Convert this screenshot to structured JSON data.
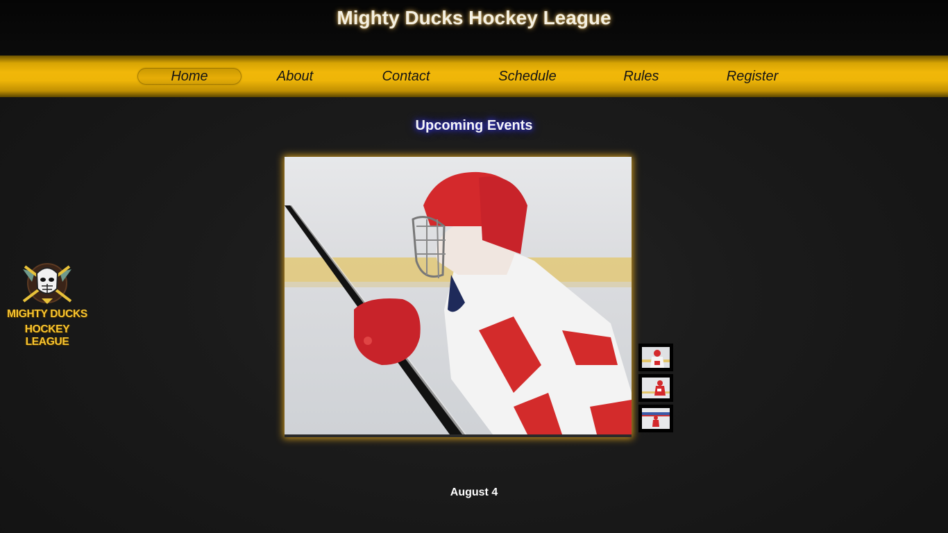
{
  "header": {
    "title": "Mighty Ducks Hockey League"
  },
  "nav": {
    "items": [
      {
        "label": "Home",
        "active": true
      },
      {
        "label": "About",
        "active": false
      },
      {
        "label": "Contact",
        "active": false
      },
      {
        "label": "Schedule",
        "active": false
      },
      {
        "label": "Rules",
        "active": false
      },
      {
        "label": "Register",
        "active": false
      }
    ]
  },
  "logo": {
    "line1": "MIGHTY DUCKS",
    "line2": "HOCKEY LEAGUE"
  },
  "events": {
    "heading": "Upcoming Events",
    "slide_date": "August 4",
    "thumbnail_count": 3
  },
  "colors": {
    "accent_gold": "#f1b709",
    "heading_glow": "#3c3cff",
    "background": "#151515"
  }
}
